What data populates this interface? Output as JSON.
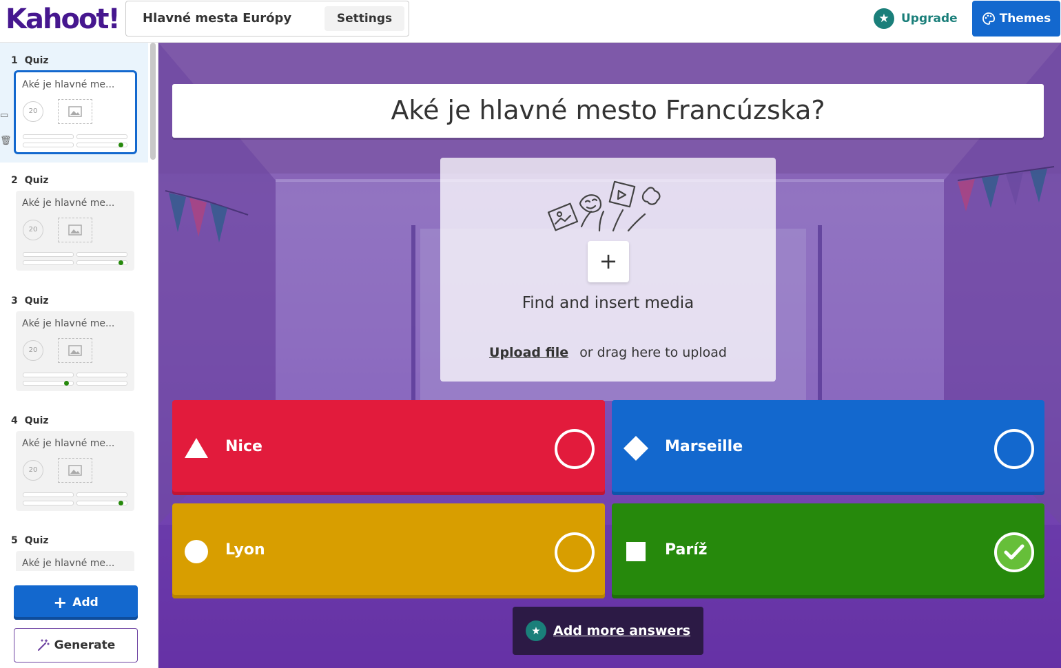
{
  "header": {
    "logo": "Kahoot!",
    "quiz_title": "Hlavné mesta Európy",
    "settings_label": "Settings",
    "upgrade_label": "Upgrade",
    "themes_label": "Themes"
  },
  "sidebar": {
    "slides": [
      {
        "number": "1",
        "type": "Quiz",
        "question": "Aké je hlavné me...",
        "time": "20"
      },
      {
        "number": "2",
        "type": "Quiz",
        "question": "Aké je hlavné me...",
        "time": "20"
      },
      {
        "number": "3",
        "type": "Quiz",
        "question": "Aké je hlavné me...",
        "time": "20"
      },
      {
        "number": "4",
        "type": "Quiz",
        "question": "Aké je hlavné me...",
        "time": "20"
      },
      {
        "number": "5",
        "type": "Quiz",
        "question": "Aké je hlavné me...",
        "time": ""
      }
    ],
    "add_label": "Add",
    "generate_label": "Generate"
  },
  "editor": {
    "question": "Aké je hlavné mesto Francúzska?",
    "media": {
      "title": "Find and insert media",
      "upload_link": "Upload file",
      "upload_hint": "or drag here to upload"
    },
    "answers": [
      {
        "text": "Nice",
        "shape": "triangle-icon",
        "color": "#e21b3c",
        "correct": false
      },
      {
        "text": "Marseille",
        "shape": "diamond-icon",
        "color": "#1368ce",
        "correct": false
      },
      {
        "text": "Lyon",
        "shape": "circle-icon",
        "color": "#d89e00",
        "correct": false
      },
      {
        "text": "Paríž",
        "shape": "square-icon",
        "color": "#26890c",
        "correct": true
      }
    ],
    "add_more_label": "Add more answers"
  },
  "colors": {
    "brand": "#46178f",
    "primary_blue": "#1368ce",
    "teal": "#1a7f7a",
    "correct_green": "#66bf39"
  }
}
